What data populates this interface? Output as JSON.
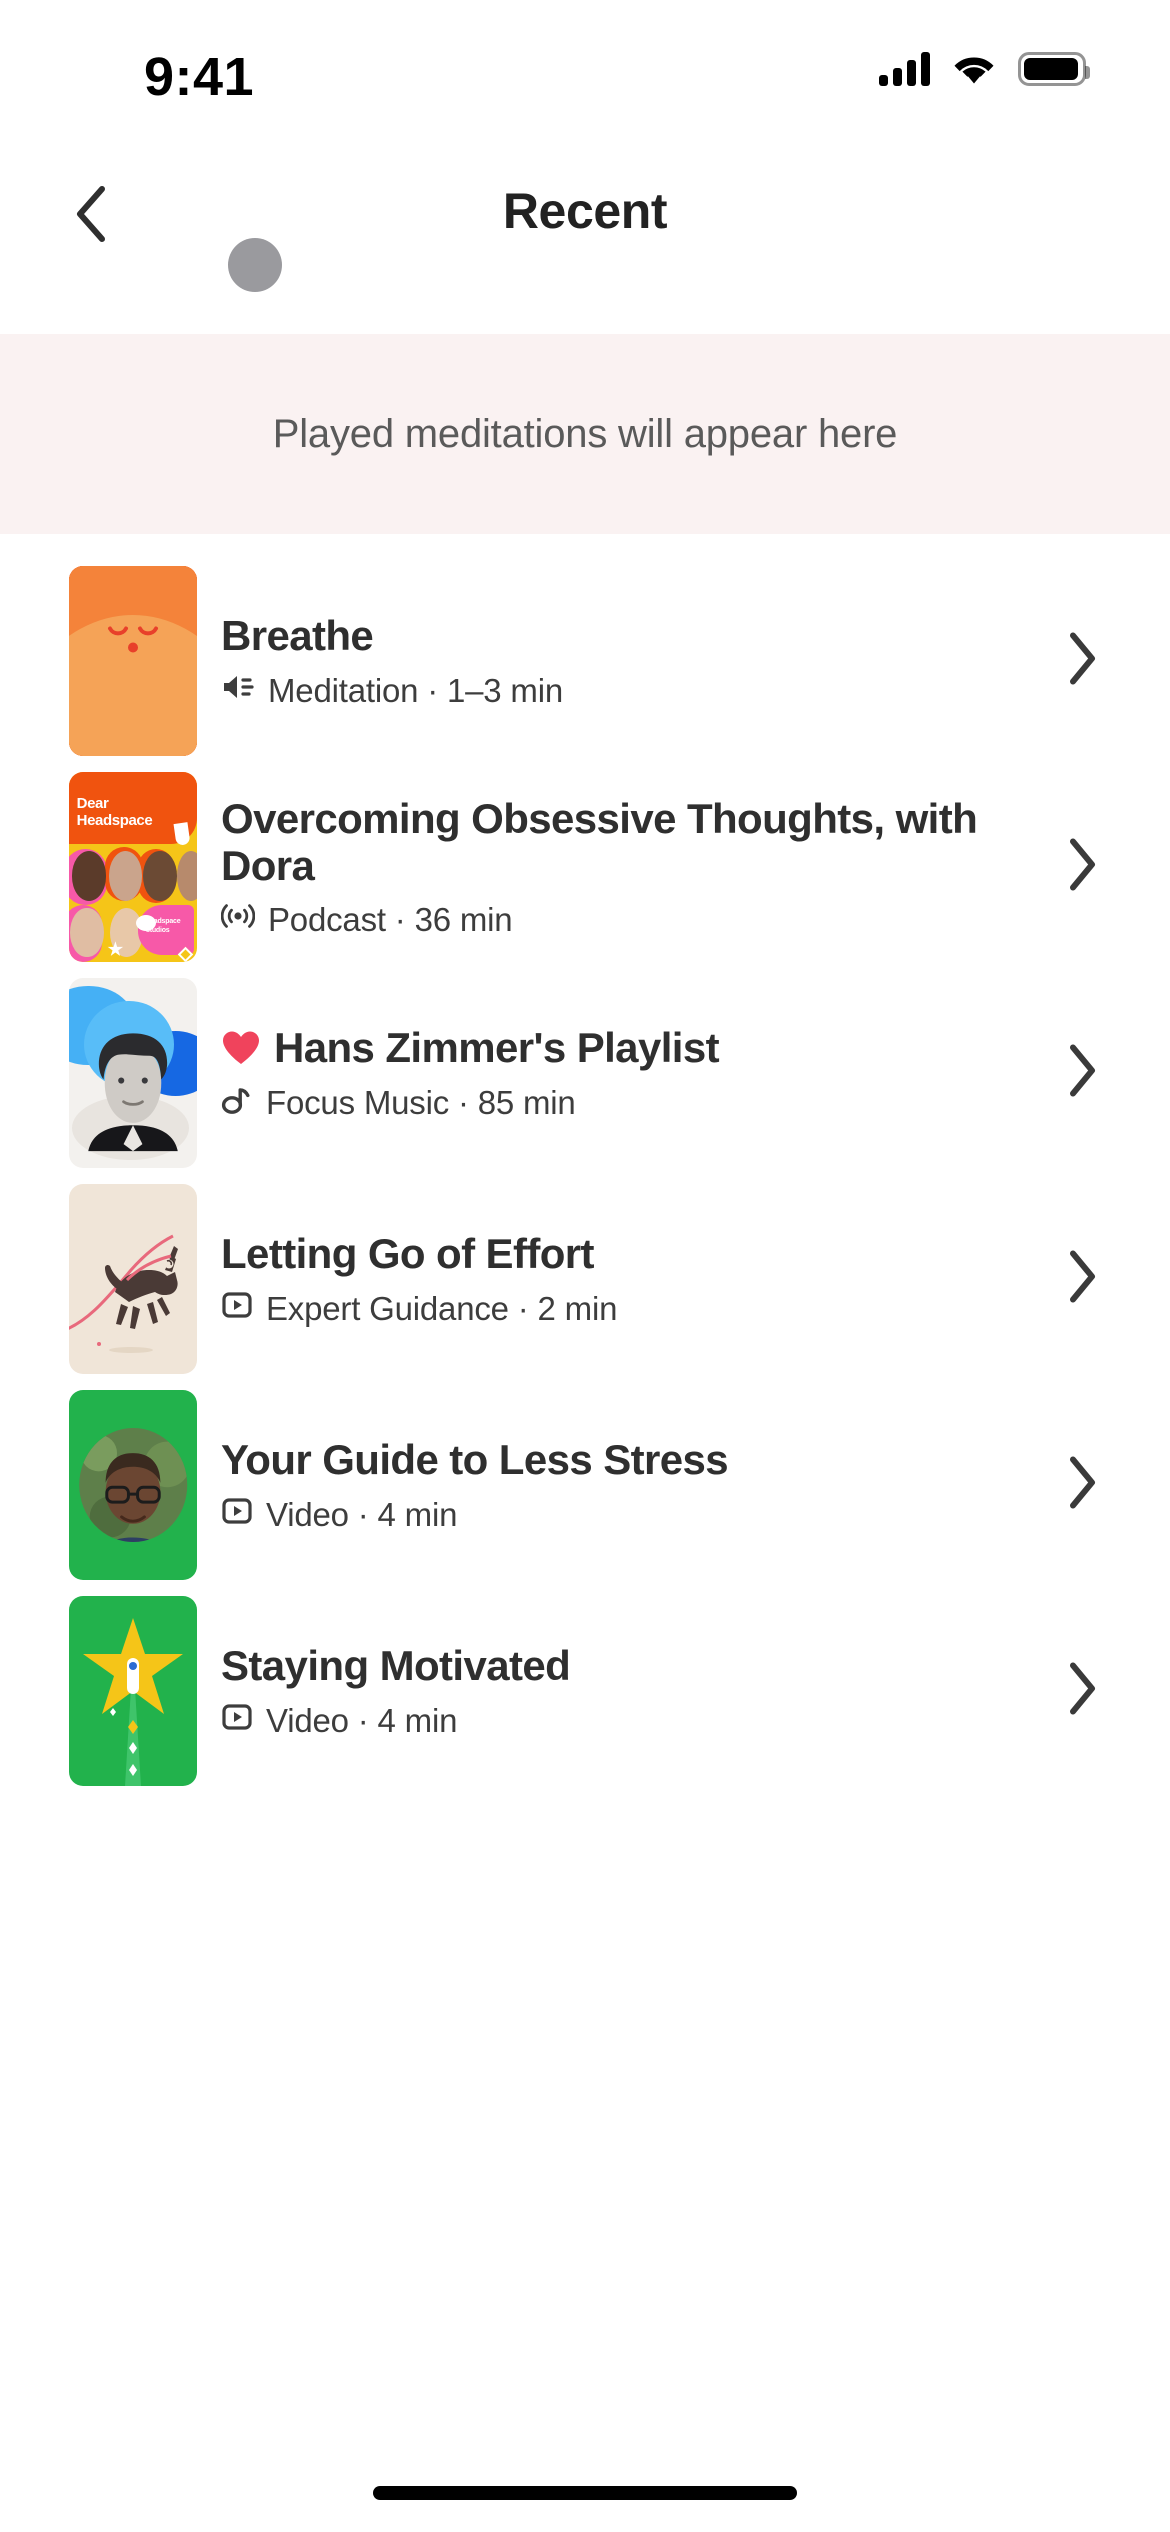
{
  "status_bar": {
    "time": "9:41",
    "cellular_icon": "signal-bars-icon",
    "wifi_icon": "wifi-icon",
    "battery_icon": "battery-full-icon"
  },
  "header": {
    "back_icon": "chevron-left-icon",
    "title": "Recent",
    "loading_indicator": "gray-dot-indicator"
  },
  "banner": {
    "text": "Played meditations will appear here",
    "background_color": "#faf2f2"
  },
  "list": {
    "chevron_icon": "chevron-right-icon",
    "items": [
      {
        "title": "Breathe",
        "type_icon": "speaker-waves-icon",
        "type": "Meditation",
        "separator": "·",
        "duration": "1–3 min",
        "subtitle": "Meditation · 1–3 min",
        "favorite": false,
        "thumbnail": "breathe-sunrise-face-art",
        "thumbnail_colors": [
          "#e8402a",
          "#f0581c",
          "#f26c26",
          "#f4833a",
          "#f5a357"
        ]
      },
      {
        "title": "Overcoming Obsessive Thoughts, with Dora",
        "type_icon": "podcast-broadcast-icon",
        "type": "Podcast",
        "separator": "·",
        "duration": "36 min",
        "subtitle": "Podcast · 36 min",
        "favorite": false,
        "thumbnail": "dear-headspace-podcast-art",
        "thumbnail_text": "Dear Headspace",
        "thumbnail_badge": "headspace studios",
        "thumbnail_colors": [
          "#f0530f",
          "#f5c518",
          "#f759a8"
        ]
      },
      {
        "title": "Hans Zimmer's Playlist",
        "type_icon": "music-note-icon",
        "type": "Focus Music",
        "separator": "·",
        "duration": "85 min",
        "subtitle": "Focus Music · 85 min",
        "favorite": true,
        "favorite_icon": "heart-filled-icon",
        "favorite_color": "#f0435c",
        "thumbnail": "hans-zimmer-portrait-art",
        "thumbnail_colors": [
          "#45b0f5",
          "#1668e3",
          "#f3f1ee"
        ]
      },
      {
        "title": "Letting Go of Effort",
        "type_icon": "video-play-icon",
        "type": "Expert Guidance",
        "separator": "·",
        "duration": "2 min",
        "subtitle": "Expert Guidance · 2 min",
        "favorite": false,
        "thumbnail": "horse-running-illustration",
        "thumbnail_colors": [
          "#f0e5d8",
          "#4a3a36",
          "#e8697c"
        ]
      },
      {
        "title": "Your Guide to Less Stress",
        "type_icon": "video-play-icon",
        "type": "Video",
        "separator": "·",
        "duration": "4 min",
        "subtitle": "Video · 4 min",
        "favorite": false,
        "thumbnail": "guide-portrait-green-art",
        "thumbnail_colors": [
          "#22b24c"
        ]
      },
      {
        "title": "Staying Motivated",
        "type_icon": "video-play-icon",
        "type": "Video",
        "separator": "·",
        "duration": "4 min",
        "subtitle": "Video · 4 min",
        "favorite": false,
        "thumbnail": "shooting-star-green-art",
        "thumbnail_colors": [
          "#22b24c",
          "#f5c518"
        ]
      }
    ]
  },
  "home_indicator": "home-indicator-bar"
}
